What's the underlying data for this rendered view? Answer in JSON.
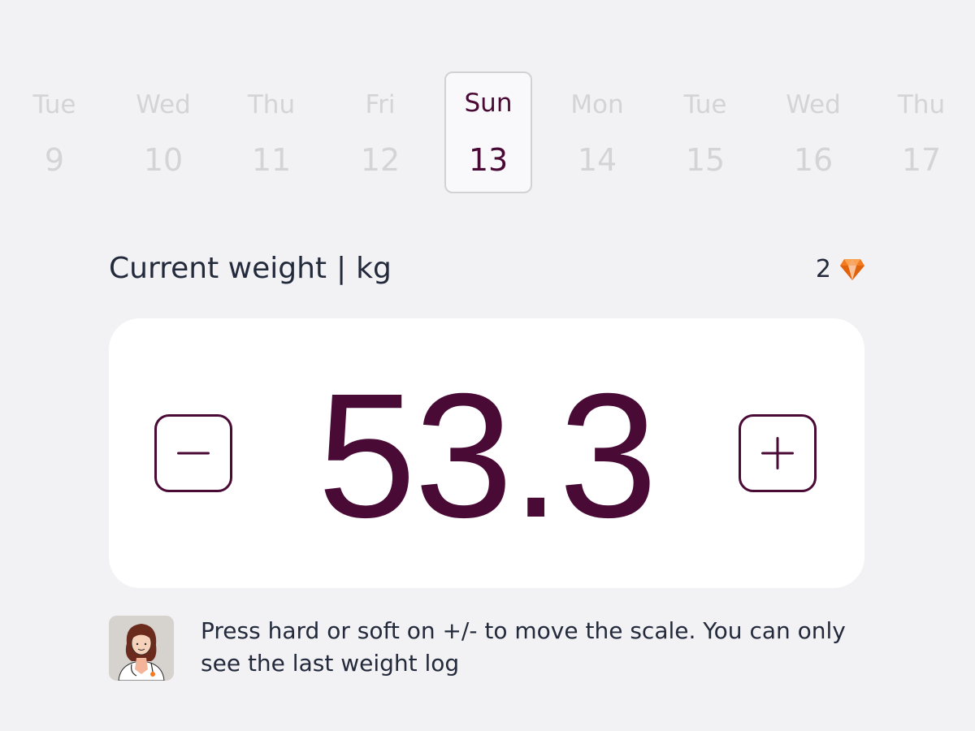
{
  "date_strip": {
    "days": [
      {
        "dow": "Tue",
        "num": "9"
      },
      {
        "dow": "Wed",
        "num": "10"
      },
      {
        "dow": "Thu",
        "num": "11"
      },
      {
        "dow": "Fri",
        "num": "12"
      },
      {
        "dow": "Sun",
        "num": "13"
      },
      {
        "dow": "Mon",
        "num": "14"
      },
      {
        "dow": "Tue",
        "num": "15"
      },
      {
        "dow": "Wed",
        "num": "16"
      },
      {
        "dow": "Thu",
        "num": "17"
      }
    ],
    "selected_index": 4
  },
  "header": {
    "title": "Current weight",
    "separator": "|",
    "unit": "kg",
    "gem_count": "2",
    "gem_icon": "diamond-icon",
    "gem_color": "#f47a1f"
  },
  "weight": {
    "value": "53.3",
    "minus_icon": "minus-icon",
    "plus_icon": "plus-icon"
  },
  "hint": {
    "avatar": "doctor-avatar",
    "text": "Press hard or soft on +/- to move the scale. You can only see the last weight log"
  },
  "colors": {
    "accent": "#4a0a36",
    "background": "#f2f1f4",
    "muted_text": "#d4d3d6",
    "text": "#232a3b"
  }
}
